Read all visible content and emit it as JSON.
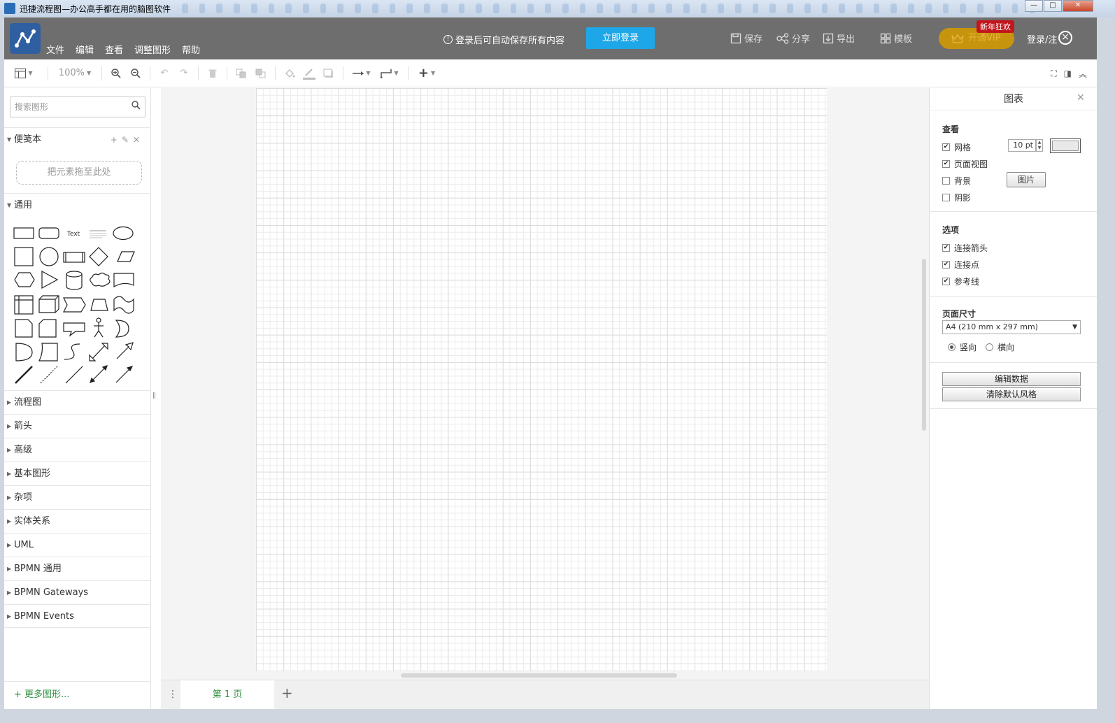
{
  "window": {
    "title": "迅捷流程图—办公高手都在用的脑图软件",
    "controls": {
      "minimize": "—",
      "maximize": "□",
      "close": "✕"
    }
  },
  "header": {
    "menu": [
      "文件",
      "编辑",
      "查看",
      "调整图形",
      "帮助"
    ],
    "login_notice": "登录后可自动保存所有内容",
    "login_button": "立即登录",
    "save": "保存",
    "share": "分享",
    "export": "导出",
    "template": "模板",
    "vip": "开通VIP",
    "vip_badge": "新年狂欢",
    "user_login": "登录/注"
  },
  "toolbar": {
    "zoom": "100%"
  },
  "sidebar": {
    "search_placeholder": "搜索图形",
    "scratchpad": {
      "label": "便笺本",
      "dropzone": "把元素拖至此处"
    },
    "general": {
      "label": "通用",
      "text_shape": "Text"
    },
    "sections": [
      "流程图",
      "箭头",
      "高级",
      "基本图形",
      "杂项",
      "实体关系",
      "UML",
      "BPMN 通用",
      "BPMN Gateways",
      "BPMN Events"
    ],
    "more_shapes": "+ 更多图形..."
  },
  "pages": {
    "current": "第 1 页"
  },
  "format_panel": {
    "title": "图表",
    "view": {
      "title": "查看",
      "grid": {
        "label": "网格",
        "checked": true,
        "size": "10 pt"
      },
      "page_view": {
        "label": "页面视图",
        "checked": true
      },
      "background": {
        "label": "背景",
        "checked": false,
        "button": "图片"
      },
      "shadow": {
        "label": "阴影",
        "checked": false
      }
    },
    "options": {
      "title": "选项",
      "connection_arrows": {
        "label": "连接箭头",
        "checked": true
      },
      "connection_points": {
        "label": "连接点",
        "checked": true
      },
      "guides": {
        "label": "参考线",
        "checked": true
      }
    },
    "page_size": {
      "title": "页面尺寸",
      "selected": "A4 (210 mm x 297 mm)",
      "portrait": "竖向",
      "landscape": "横向",
      "orientation": "portrait"
    },
    "edit_data": "编辑数据",
    "clear_default_style": "清除默认风格"
  },
  "colors": {
    "header_bg": "#6e6e6e",
    "login_button": "#1ea7e8",
    "vip": "#c7940d",
    "vip_badge": "#c3161c",
    "accent_green": "#2f8f3e"
  }
}
